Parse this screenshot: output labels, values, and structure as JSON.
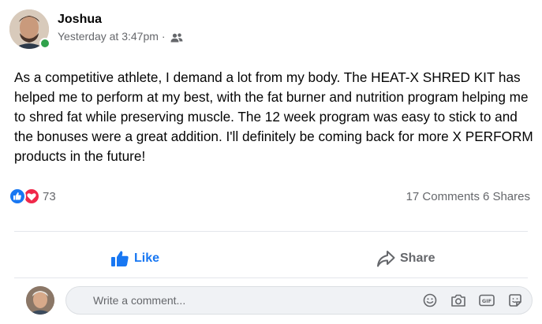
{
  "post": {
    "author": "Joshua",
    "timestamp": "Yesterday at 3:47pm",
    "separator": "·",
    "audience_icon": "friends-icon",
    "body": "As a competitive athlete, I demand a lot from my body. The HEAT-X SHRED KIT has helped me to perform at my best, with the fat burner and nutrition program helping me to shred fat while preserving muscle. The 12 week program was easy to stick to and the bonuses were a great addition. I'll definitely be coming back for more X PERFORM products in the future!"
  },
  "engagement": {
    "reaction_icons": [
      "like-icon",
      "love-icon"
    ],
    "reaction_count": "73",
    "comments": "17 Comments",
    "shares": "6 Shares"
  },
  "actions": {
    "like_label": "Like",
    "share_label": "Share"
  },
  "comment_box": {
    "placeholder": "Write a comment...",
    "tools": [
      "emoji-icon",
      "camera-icon",
      "gif-icon",
      "sticker-icon"
    ]
  },
  "colors": {
    "brand_blue": "#1877f2",
    "love_red": "#f0284a",
    "online_green": "#31a24c",
    "secondary_text": "#65676b"
  }
}
